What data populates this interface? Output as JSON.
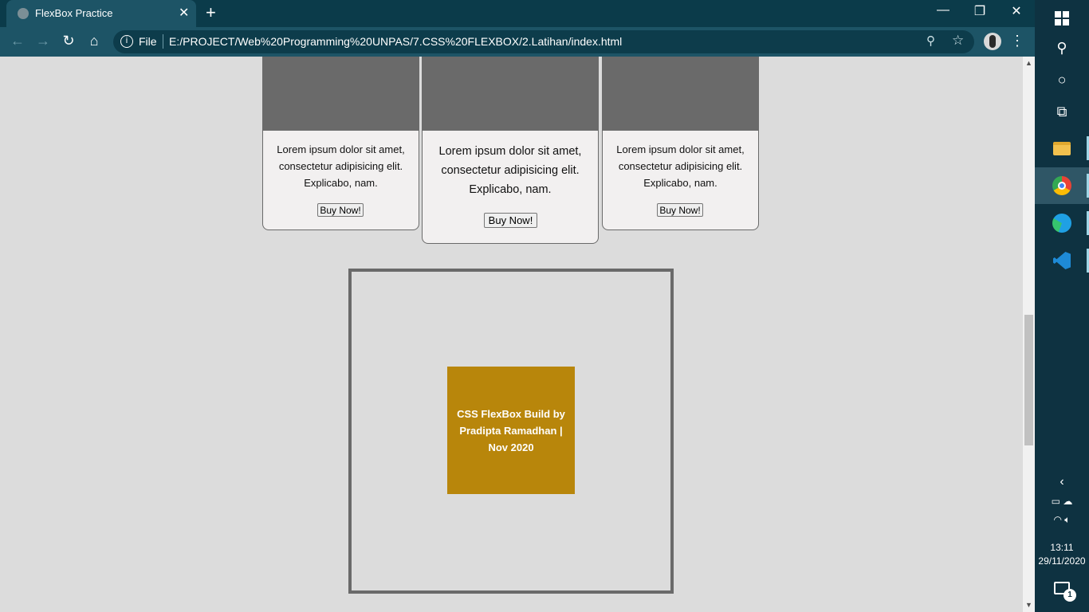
{
  "browser": {
    "tab_title": "FlexBox Practice",
    "tab_close": "✕",
    "new_tab": "+",
    "url_scheme_label": "File",
    "url": "E:/PROJECT/Web%20Programming%20UNPAS/7.CSS%20FLEXBOX/2.Latihan/index.html",
    "minimize": "—",
    "restore": "❐",
    "close": "✕"
  },
  "page": {
    "cards": [
      {
        "text": "Lorem ipsum dolor sit amet, consectetur adipisicing elit. Explicabo, nam.",
        "button": "Buy Now!"
      },
      {
        "text": "Lorem ipsum dolor sit amet, consectetur adipisicing elit. Explicabo, nam.",
        "button": "Buy Now!"
      },
      {
        "text": "Lorem ipsum dolor sit amet, consectetur adipisicing elit. Explicabo, nam.",
        "button": "Buy Now!"
      }
    ],
    "footer_box": "CSS FlexBox Build by Pradipta Ramadhan | Nov 2020",
    "colors": {
      "background": "#dcdcdc",
      "card_image": "#6a6a6a",
      "footer_box": "#b8860b"
    }
  },
  "taskbar": {
    "time": "13:11",
    "date": "29/11/2020",
    "notifications": "1",
    "icons": [
      "windows-start-icon",
      "search-icon",
      "cortana-icon",
      "task-view-icon",
      "file-explorer-icon",
      "chrome-icon",
      "edge-icon",
      "vscode-icon"
    ]
  }
}
